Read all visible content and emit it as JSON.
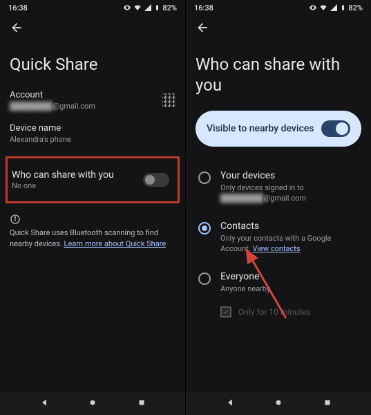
{
  "status": {
    "time": "16:38",
    "battery": "82%"
  },
  "screenLeft": {
    "title": "Quick Share",
    "account": {
      "label": "Account",
      "emailMasked": "████████",
      "emailDomain": "@gmail.com"
    },
    "device": {
      "label": "Device name",
      "value": "Alexandra's phone"
    },
    "share": {
      "title": "Who can share with you",
      "sub": "No one"
    },
    "info": {
      "text": "Quick Share uses Bluetooth scanning to find nearby devices. ",
      "link": "Learn more about Quick Share"
    }
  },
  "screenRight": {
    "title": "Who can share with you",
    "pill": "Visible to nearby devices",
    "options": {
      "devices": {
        "title": "Your devices",
        "sub1": "Only devices signed in to",
        "subMasked": "████████",
        "subDomain": "@gmail.com"
      },
      "contacts": {
        "title": "Contacts",
        "sub": "Only your contacts with a Google Account. ",
        "link": "View contacts"
      },
      "everyone": {
        "title": "Everyone",
        "sub": "Anyone nearby"
      }
    },
    "checkbox": "Only for 10 minutes"
  }
}
